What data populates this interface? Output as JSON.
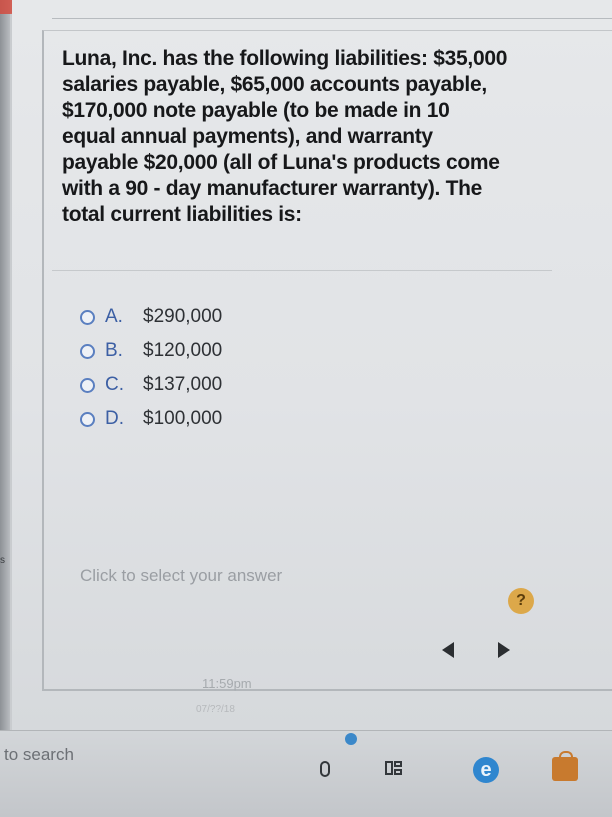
{
  "question": {
    "lines": [
      "Luna, Inc. has the following liabilities: $35,000",
      "salaries payable, $65,000 accounts payable,",
      "$170,000 note payable (to be made in 10",
      "equal annual payments), and warranty",
      "payable $20,000 (all of Luna's products come",
      "with a 90 - day manufacturer warranty). The",
      "total current liabilities is:"
    ]
  },
  "options": [
    {
      "letter": "A.",
      "value": "$290,000"
    },
    {
      "letter": "B.",
      "value": "$120,000"
    },
    {
      "letter": "C.",
      "value": "$137,000"
    },
    {
      "letter": "D.",
      "value": "$100,000"
    }
  ],
  "answer": {
    "placeholder": "Click to select your answer"
  },
  "help_label": "?",
  "footer": {
    "time": "11:59pm",
    "date": "07/??/18"
  },
  "taskbar": {
    "search_text": "to search"
  },
  "side_letter": "s",
  "icons": {
    "help": "help-icon",
    "prev": "prev-arrow-icon",
    "next": "next-arrow-icon",
    "mic": "microphone-icon",
    "task_view": "task-view-icon",
    "edge": "edge-browser-icon",
    "store": "store-icon"
  },
  "colors": {
    "radio_ring": "#5a7fc0",
    "option_letter": "#3c5fa4",
    "help_button": "#dca84a",
    "edge": "#2f86cf",
    "store": "#c87a2e"
  }
}
